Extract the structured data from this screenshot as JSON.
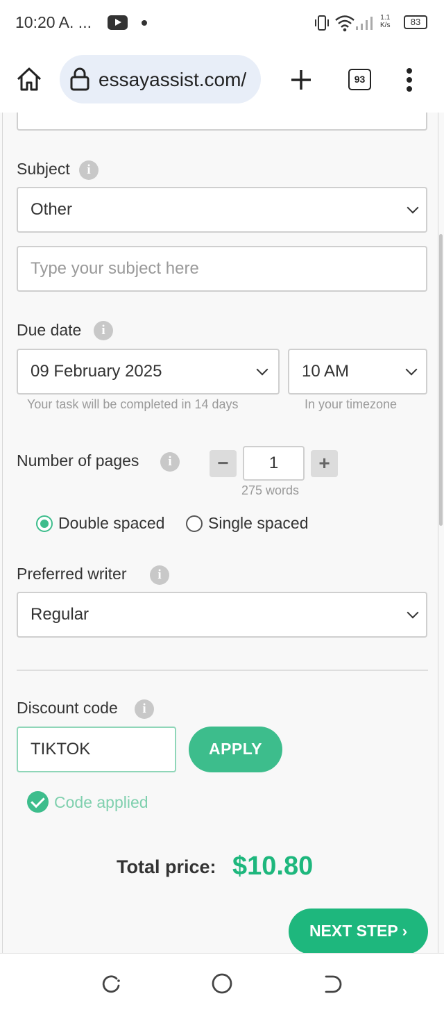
{
  "status_bar": {
    "time": "10:20 A. ...",
    "net_speed_value": "1.1",
    "net_speed_unit": "K/s",
    "battery": "83",
    "icons": [
      "youtube-icon",
      "vibrate-icon",
      "wifi-icon",
      "signal-icon",
      "battery-icon"
    ]
  },
  "browser": {
    "url": "essayassist.com/",
    "tab_count": "93",
    "icons": [
      "home-icon",
      "lock-icon",
      "new-tab-icon",
      "more-vert-icon"
    ]
  },
  "form": {
    "subject": {
      "label": "Subject",
      "selected": "Other",
      "custom_placeholder": "Type your subject here"
    },
    "due_date": {
      "label": "Due date",
      "date": "09 February 2025",
      "time": "10 AM",
      "date_hint": "Your task will be completed in 14 days",
      "time_hint": "In your timezone"
    },
    "pages": {
      "label": "Number of pages",
      "value": "1",
      "minus": "−",
      "plus": "+",
      "words": "275 words"
    },
    "spacing": {
      "options": [
        "Double spaced",
        "Single spaced"
      ],
      "selected": "Double spaced"
    },
    "writer": {
      "label": "Preferred writer",
      "selected": "Regular"
    },
    "discount": {
      "label": "Discount code",
      "value": "TIKTOK",
      "apply_label": "APPLY",
      "status": "Code applied"
    },
    "total": {
      "label": "Total price:",
      "value": "$10.80"
    },
    "next_label": "NEXT STEP"
  },
  "colors": {
    "accent": "#3dbd8c",
    "price": "#1eb77d",
    "next_button": "#1eb77d",
    "url_pill": "#e8eef8"
  }
}
